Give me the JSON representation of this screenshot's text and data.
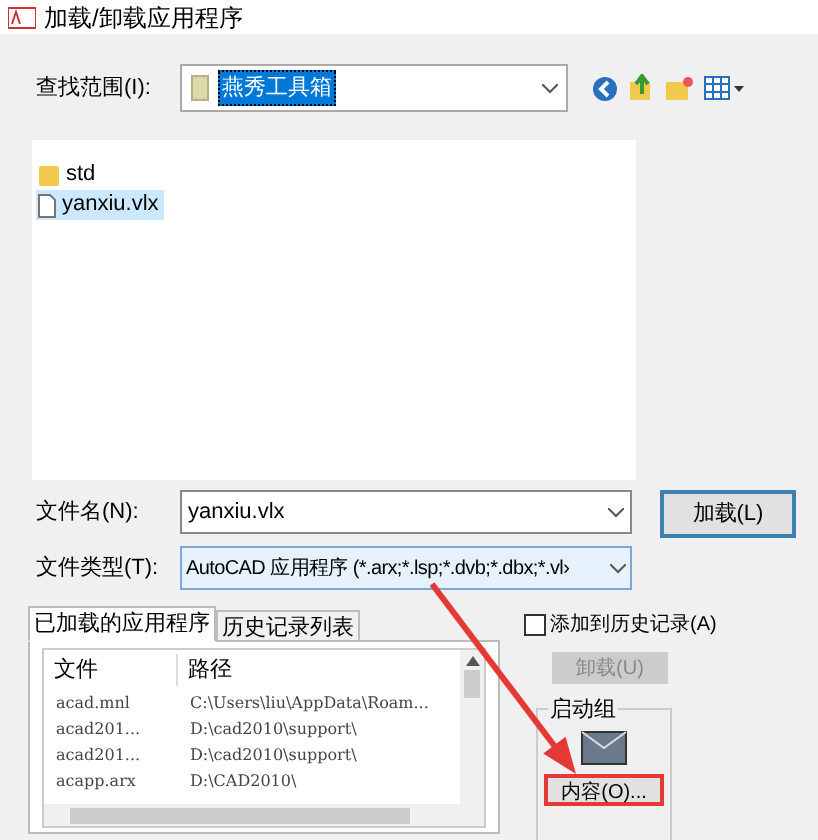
{
  "window": {
    "title": "加载/卸载应用程序"
  },
  "look_in": {
    "label": "查找范围(I):",
    "value": "燕秀工具箱"
  },
  "files": [
    {
      "name": "std",
      "kind": "folder",
      "selected": false
    },
    {
      "name": "yanxiu.vlx",
      "kind": "file",
      "selected": true
    }
  ],
  "file_name": {
    "label": "文件名(N):",
    "value": "yanxiu.vlx"
  },
  "file_type": {
    "label": "文件类型(T):",
    "value": "AutoCAD 应用程序 (*.arx;*.lsp;*.dvb;*.dbx;*.vl›"
  },
  "load_button": "加载(L)",
  "tabs": [
    {
      "label": "已加载的应用程序",
      "selected": true
    },
    {
      "label": "历史记录列表",
      "selected": false
    }
  ],
  "loaded_table": {
    "columns": [
      "文件",
      "路径"
    ],
    "rows": [
      [
        "acad.mnl",
        "C:\\Users\\liu\\AppData\\Roam..."
      ],
      [
        "acad201...",
        "D:\\cad2010\\support\\"
      ],
      [
        "acad201...",
        "D:\\cad2010\\support\\"
      ],
      [
        "acapp.arx",
        "D:\\CAD2010\\"
      ]
    ]
  },
  "add_to_history": {
    "label": "添加到历史记录(A)",
    "checked": false
  },
  "unload_button": {
    "label": "卸载(U)",
    "disabled": true
  },
  "startup_group": {
    "title": "启动组",
    "contents_button": "内容(O)..."
  }
}
